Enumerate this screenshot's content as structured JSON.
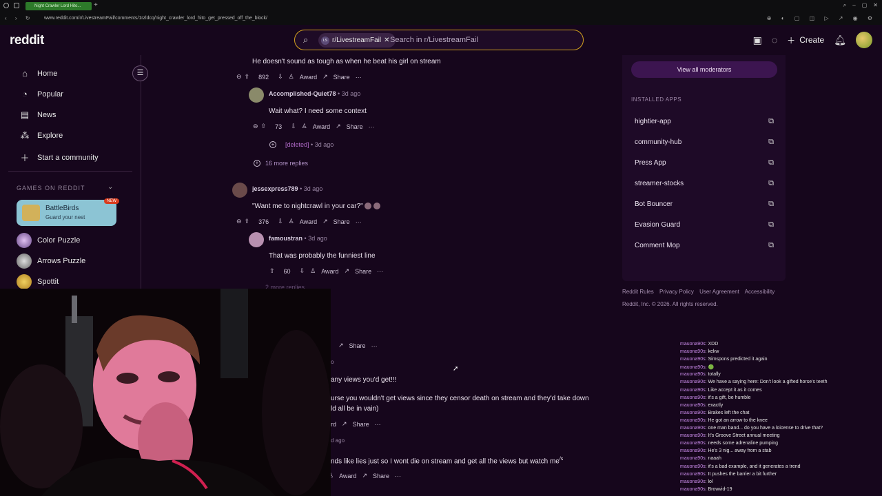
{
  "browser": {
    "tab_title": "Night Crawler Lord Hito...",
    "url": "www.reddit.com/r/LivestreamFail/comments/1rzldcq/night_crawler_lord_hito_get_pressed_off_the_block/"
  },
  "header": {
    "logo": "reddit",
    "search_chip": "r/LivestreamFail",
    "search_placeholder": "Search in r/LivestreamFail",
    "create_label": "Create"
  },
  "sidebar": {
    "items": [
      {
        "label": "Home",
        "icon": "home-icon"
      },
      {
        "label": "Popular",
        "icon": "popular-icon"
      },
      {
        "label": "News",
        "icon": "news-icon"
      },
      {
        "label": "Explore",
        "icon": "explore-icon"
      },
      {
        "label": "Start a community",
        "icon": "plus-icon"
      }
    ],
    "games_title": "GAMES ON REDDIT",
    "featured_game": {
      "title": "BattleBirds",
      "subtitle": "Guard your nest",
      "badge": "NEW"
    },
    "games": [
      "Color Puzzle",
      "Arrows Puzzle",
      "Spottit"
    ]
  },
  "comments": {
    "c1": {
      "text": "He doesn't sound as tough as when he beat his girl on stream",
      "votes": "892"
    },
    "c2": {
      "user": "Accomplished-Quiet78",
      "time": "3d ago",
      "text": "Wait what? I need some context",
      "votes": "73"
    },
    "c3": {
      "user": "[deleted]",
      "time": "3d ago"
    },
    "more1": "16 more replies",
    "c4": {
      "user": "jessexpress789",
      "time": "3d ago",
      "text": "\"Want me to nightcrawl in your car?\"",
      "votes": "376"
    },
    "c5": {
      "user": "famoustran",
      "time": "3d ago",
      "text": "That was probably the funniest line",
      "votes": "60"
    },
    "more2": "2 more replies",
    "partial1": "any views you'd get!!!",
    "partial2": "urse you wouldn't get views since they censor death on stream and they'd take down",
    "partial3": "ld all be in vain)",
    "partial4": "nds like lies just so I wont die on stream and get all the views but watch me",
    "partial4_sup": "/s",
    "time_partial": "d ago",
    "time_partial2": "o"
  },
  "actions": {
    "award": "Award",
    "share": "Share",
    "more": "···"
  },
  "rightpanel": {
    "mods_button": "View all moderators",
    "apps_title": "INSTALLED APPS",
    "apps": [
      "hightier-app",
      "community-hub",
      "Press App",
      "streamer-stocks",
      "Bot Bouncer",
      "Evasion Guard",
      "Comment Mop"
    ]
  },
  "footer": {
    "links": [
      "Reddit Rules",
      "Privacy Policy",
      "User Agreement",
      "Accessibility"
    ],
    "copyright": "Reddit, Inc. © 2026. All rights reserved."
  },
  "chat": {
    "user": "mauona90s",
    "messages": [
      "XDD",
      "kekw",
      "Simspons predicted it again",
      "🟢",
      "totally",
      "We have a saying here: Don't look a gifted horse's teeth",
      "Like accept it as it comes",
      "it's a gift, be humble",
      "exactly",
      "Brakes left the chat",
      "He got an arrow to the knee",
      "one man band... do you have a loicense to drive that?",
      "It's Groove Street annual meeting",
      "needs some adrenaline pumping",
      "He's 3 nig... away from a stab",
      "naaah",
      "it's a bad example, and it generates a trend",
      "It pushes the barrier a bit further",
      "lol",
      "Browvid-19"
    ]
  }
}
